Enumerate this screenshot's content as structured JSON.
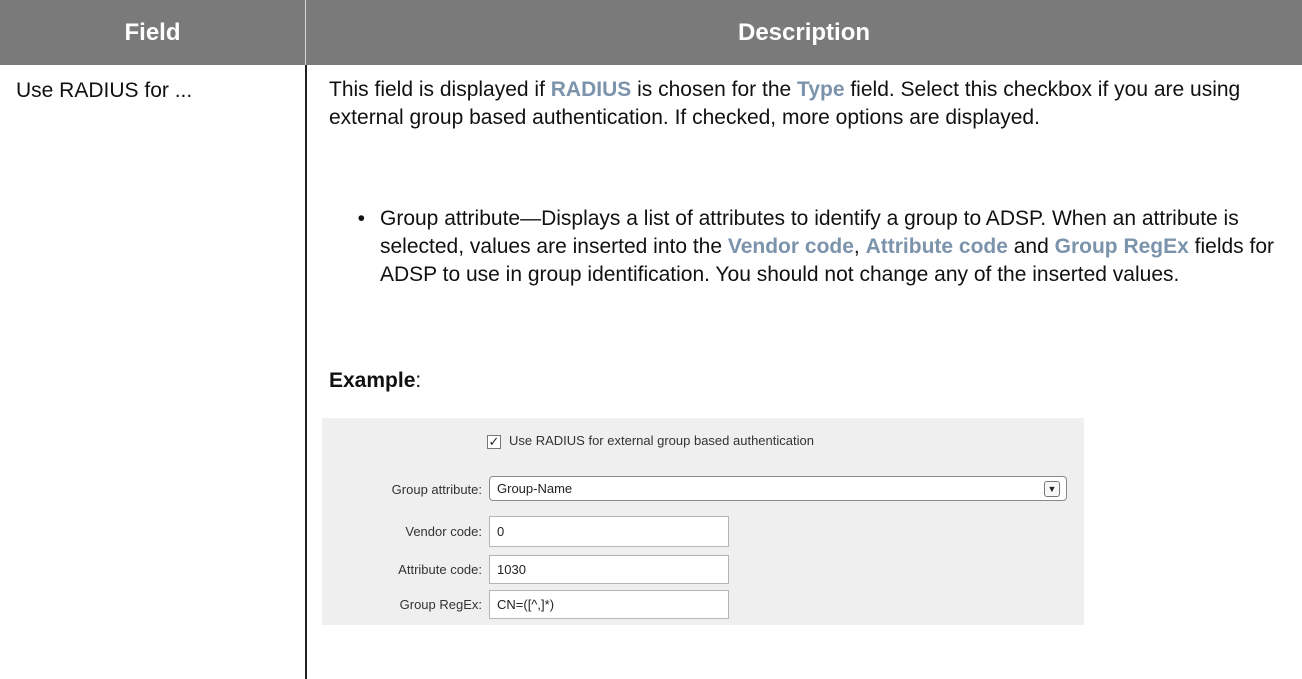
{
  "table": {
    "header": {
      "field": "Field",
      "description": "Description"
    },
    "row": {
      "field": "Use RADIUS for ...",
      "desc_part1": "This field is displayed if ",
      "desc_kw1": "RADIUS",
      "desc_part2": " is chosen for the ",
      "desc_kw2": "Type",
      "desc_part3": " field. Select this checkbox if you are using external group based authentication. If checked, more options are displayed.",
      "bullet_marker": "•",
      "bullet_part1": "Group attribute—Displays a list of attributes to identify a group to ADSP. When an attribute is selected, values are inserted into the ",
      "bullet_kw1": "Vendor code",
      "bullet_sep1": ", ",
      "bullet_kw2": "Attribute code",
      "bullet_sep2": " and ",
      "bullet_kw3": "Group RegEx",
      "bullet_part2": " fields for ADSP to use in group identification. You should not change any of the inserted values.",
      "example_label": "Example",
      "example_colon": ":"
    }
  },
  "example_form": {
    "checkbox_label": "Use RADIUS for external group based authentication",
    "checkbox_checked": true,
    "checkbox_mark": "✓",
    "group_attribute_label": "Group attribute:",
    "group_attribute_value": "Group-Name",
    "dropdown_icon": "▼",
    "vendor_code_label": "Vendor code:",
    "vendor_code_value": "0",
    "attribute_code_label": "Attribute code:",
    "attribute_code_value": "1030",
    "group_regex_label": "Group RegEx:",
    "group_regex_value": "CN=([^,]*)"
  },
  "colors": {
    "header_bg": "#7a7a7a",
    "keyword": "#7c93ac",
    "panel_bg": "#efefef"
  }
}
